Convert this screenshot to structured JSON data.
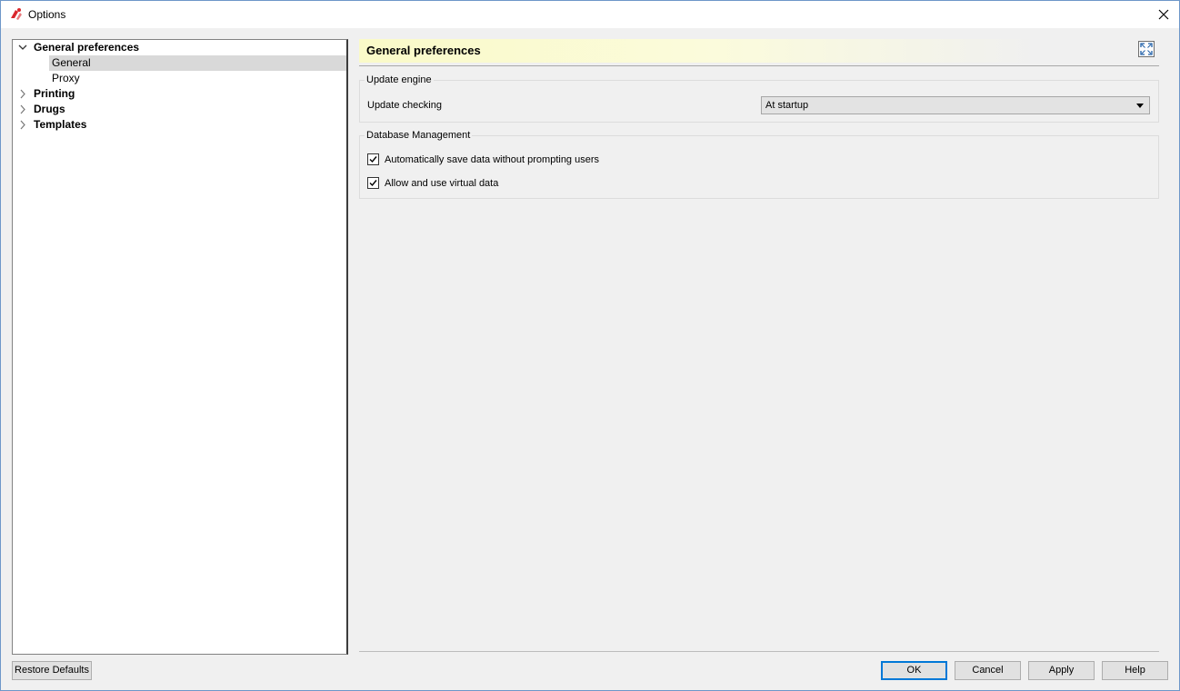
{
  "window": {
    "title": "Options",
    "icons": {
      "app": "app-logo-icon",
      "close": "close-icon"
    }
  },
  "tree": {
    "items": [
      {
        "label": "General preferences",
        "expanded": true,
        "icon": "chevron-down-icon",
        "children": [
          {
            "label": "General",
            "selected": true
          },
          {
            "label": "Proxy",
            "selected": false
          }
        ]
      },
      {
        "label": "Printing",
        "expanded": false,
        "icon": "chevron-right-icon"
      },
      {
        "label": "Drugs",
        "expanded": false,
        "icon": "chevron-right-icon"
      },
      {
        "label": "Templates",
        "expanded": false,
        "icon": "chevron-right-icon"
      }
    ]
  },
  "page": {
    "title": "General preferences",
    "expand_icon": "fullscreen-icon",
    "update_engine": {
      "group_title": "Update engine",
      "update_checking_label": "Update checking",
      "update_checking_value": "At startup"
    },
    "database_management": {
      "group_title": "Database Management",
      "auto_save_label": "Automatically save data without prompting users",
      "auto_save_checked": true,
      "virtual_data_label": "Allow and use virtual data",
      "virtual_data_checked": true
    }
  },
  "buttons": {
    "restore_defaults": "Restore Defaults",
    "ok": "OK",
    "cancel": "Cancel",
    "apply": "Apply",
    "help": "Help"
  },
  "colors": {
    "header_highlight": "#fafac8",
    "selection": "#d9d9d9",
    "default_button_border": "#0078d7"
  }
}
